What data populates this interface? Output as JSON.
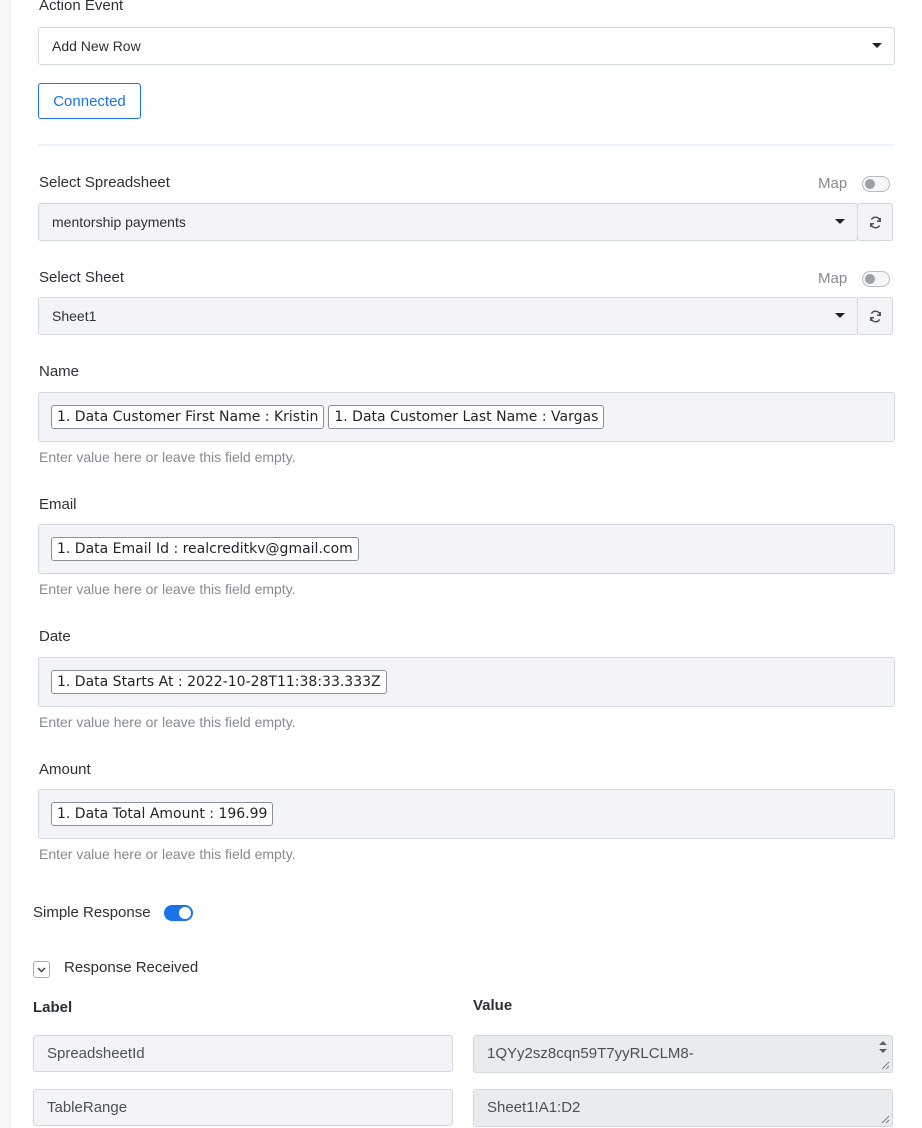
{
  "action_event": {
    "label": "Action Event",
    "selected": "Add New Row"
  },
  "connected_button": "Connected",
  "spreadsheet": {
    "label": "Select Spreadsheet",
    "map_label": "Map",
    "selected": "mentorship payments"
  },
  "sheet": {
    "label": "Select Sheet",
    "map_label": "Map",
    "selected": "Sheet1"
  },
  "fields": {
    "name": {
      "label": "Name",
      "chips": [
        "1. Data Customer First Name : Kristin",
        "1. Data Customer Last Name : Vargas"
      ],
      "hint": "Enter value here or leave this field empty."
    },
    "email": {
      "label": "Email",
      "chips": [
        "1. Data Email Id : realcreditkv@gmail.com"
      ],
      "hint": "Enter value here or leave this field empty."
    },
    "date": {
      "label": "Date",
      "chips": [
        "1. Data Starts At : 2022-10-28T11:38:33.333Z"
      ],
      "hint": "Enter value here or leave this field empty."
    },
    "amount": {
      "label": "Amount",
      "chips": [
        "1. Data Total Amount : 196.99"
      ],
      "hint": "Enter value here or leave this field empty."
    }
  },
  "simple_response": {
    "label": "Simple Response",
    "enabled": true
  },
  "response_received": {
    "label": "Response Received",
    "col_label": "Label",
    "col_value": "Value",
    "rows": [
      {
        "label": "SpreadsheetId",
        "value": "1QYy2sz8cqn59T7yyRLCLM8-"
      },
      {
        "label": "TableRange",
        "value": "Sheet1!A1:D2"
      }
    ]
  },
  "colors": {
    "accent": "#1a73e8",
    "field_bg": "#f2f4f7",
    "border": "#d3d8de"
  }
}
